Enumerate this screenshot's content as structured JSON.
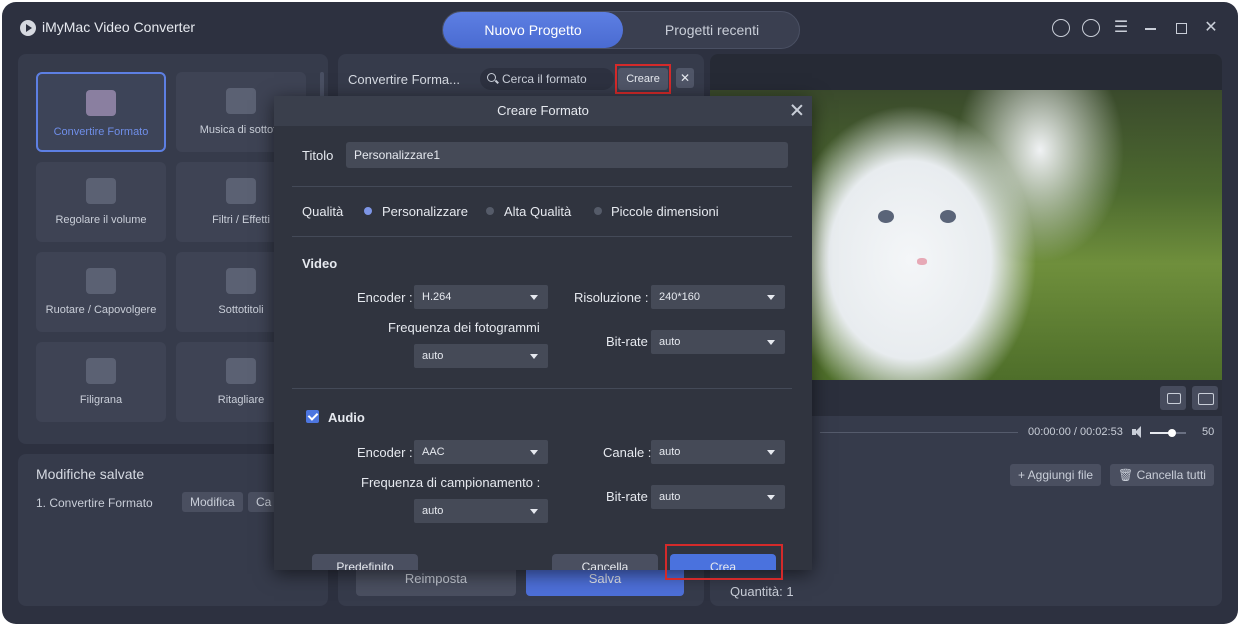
{
  "app": {
    "title": "iMyMac Video Converter"
  },
  "top_tabs": {
    "active": "Nuovo Progetto",
    "other": "Progetti recenti"
  },
  "tools": [
    {
      "label": "Convertire Formato"
    },
    {
      "label": "Musica di sottofo"
    },
    {
      "label": "Regolare il volume"
    },
    {
      "label": "Filtri / Effetti"
    },
    {
      "label": "Ruotare / Capovolgere"
    },
    {
      "label": "Sottotitoli"
    },
    {
      "label": "Filigrana"
    },
    {
      "label": "Ritagliare"
    }
  ],
  "saved": {
    "title": "Modifiche salvate",
    "item": "1.   Convertire Formato",
    "modify": "Modifica",
    "cancel_partial": "Ca"
  },
  "mid": {
    "title": "Convertire Forma...",
    "search_placeholder": "Cerca il formato",
    "create": "Creare",
    "close": "✕",
    "reset": "Reimposta",
    "save": "Salva"
  },
  "right": {
    "time": "00:00:00 / 00:02:53",
    "volume": "50",
    "volume_level": 0.6,
    "add_file": "+ Aggiungi file",
    "clear_all": "🗑 Cancella tutti",
    "quantity": "Quantità: 1"
  },
  "modal": {
    "header": "Creare Formato",
    "title_label": "Titolo",
    "title_value": "Personalizzare1",
    "quality_label": "Qualità",
    "quality_options": [
      "Personalizzare",
      "Alta Qualità",
      "Piccole dimensioni"
    ],
    "quality_selected": "Personalizzare",
    "video_label": "Video",
    "video_encoder_label": "Encoder :",
    "video_encoder": "H.264",
    "resolution_label": "Risoluzione :",
    "resolution": "240*160",
    "frame_rate_label": "Frequenza dei fotogrammi",
    "frame_rate": "auto",
    "video_bitrate_label": "Bit-rate",
    "video_bitrate": "auto",
    "audio_label": "Audio",
    "audio_checked": true,
    "audio_encoder_label": "Encoder :",
    "audio_encoder": "AAC",
    "channel_label": "Canale :",
    "channel": "auto",
    "sample_rate_label": "Frequenza di campionamento :",
    "sample_rate": "auto",
    "audio_bitrate_label": "Bit-rate",
    "audio_bitrate": "auto",
    "default_btn": "Predefinito",
    "cancel_btn": "Cancella",
    "create_btn": "Crea"
  },
  "colors": {
    "accent": "#4a72de",
    "highlight": "#d42a2a",
    "background": "#2d3140"
  }
}
